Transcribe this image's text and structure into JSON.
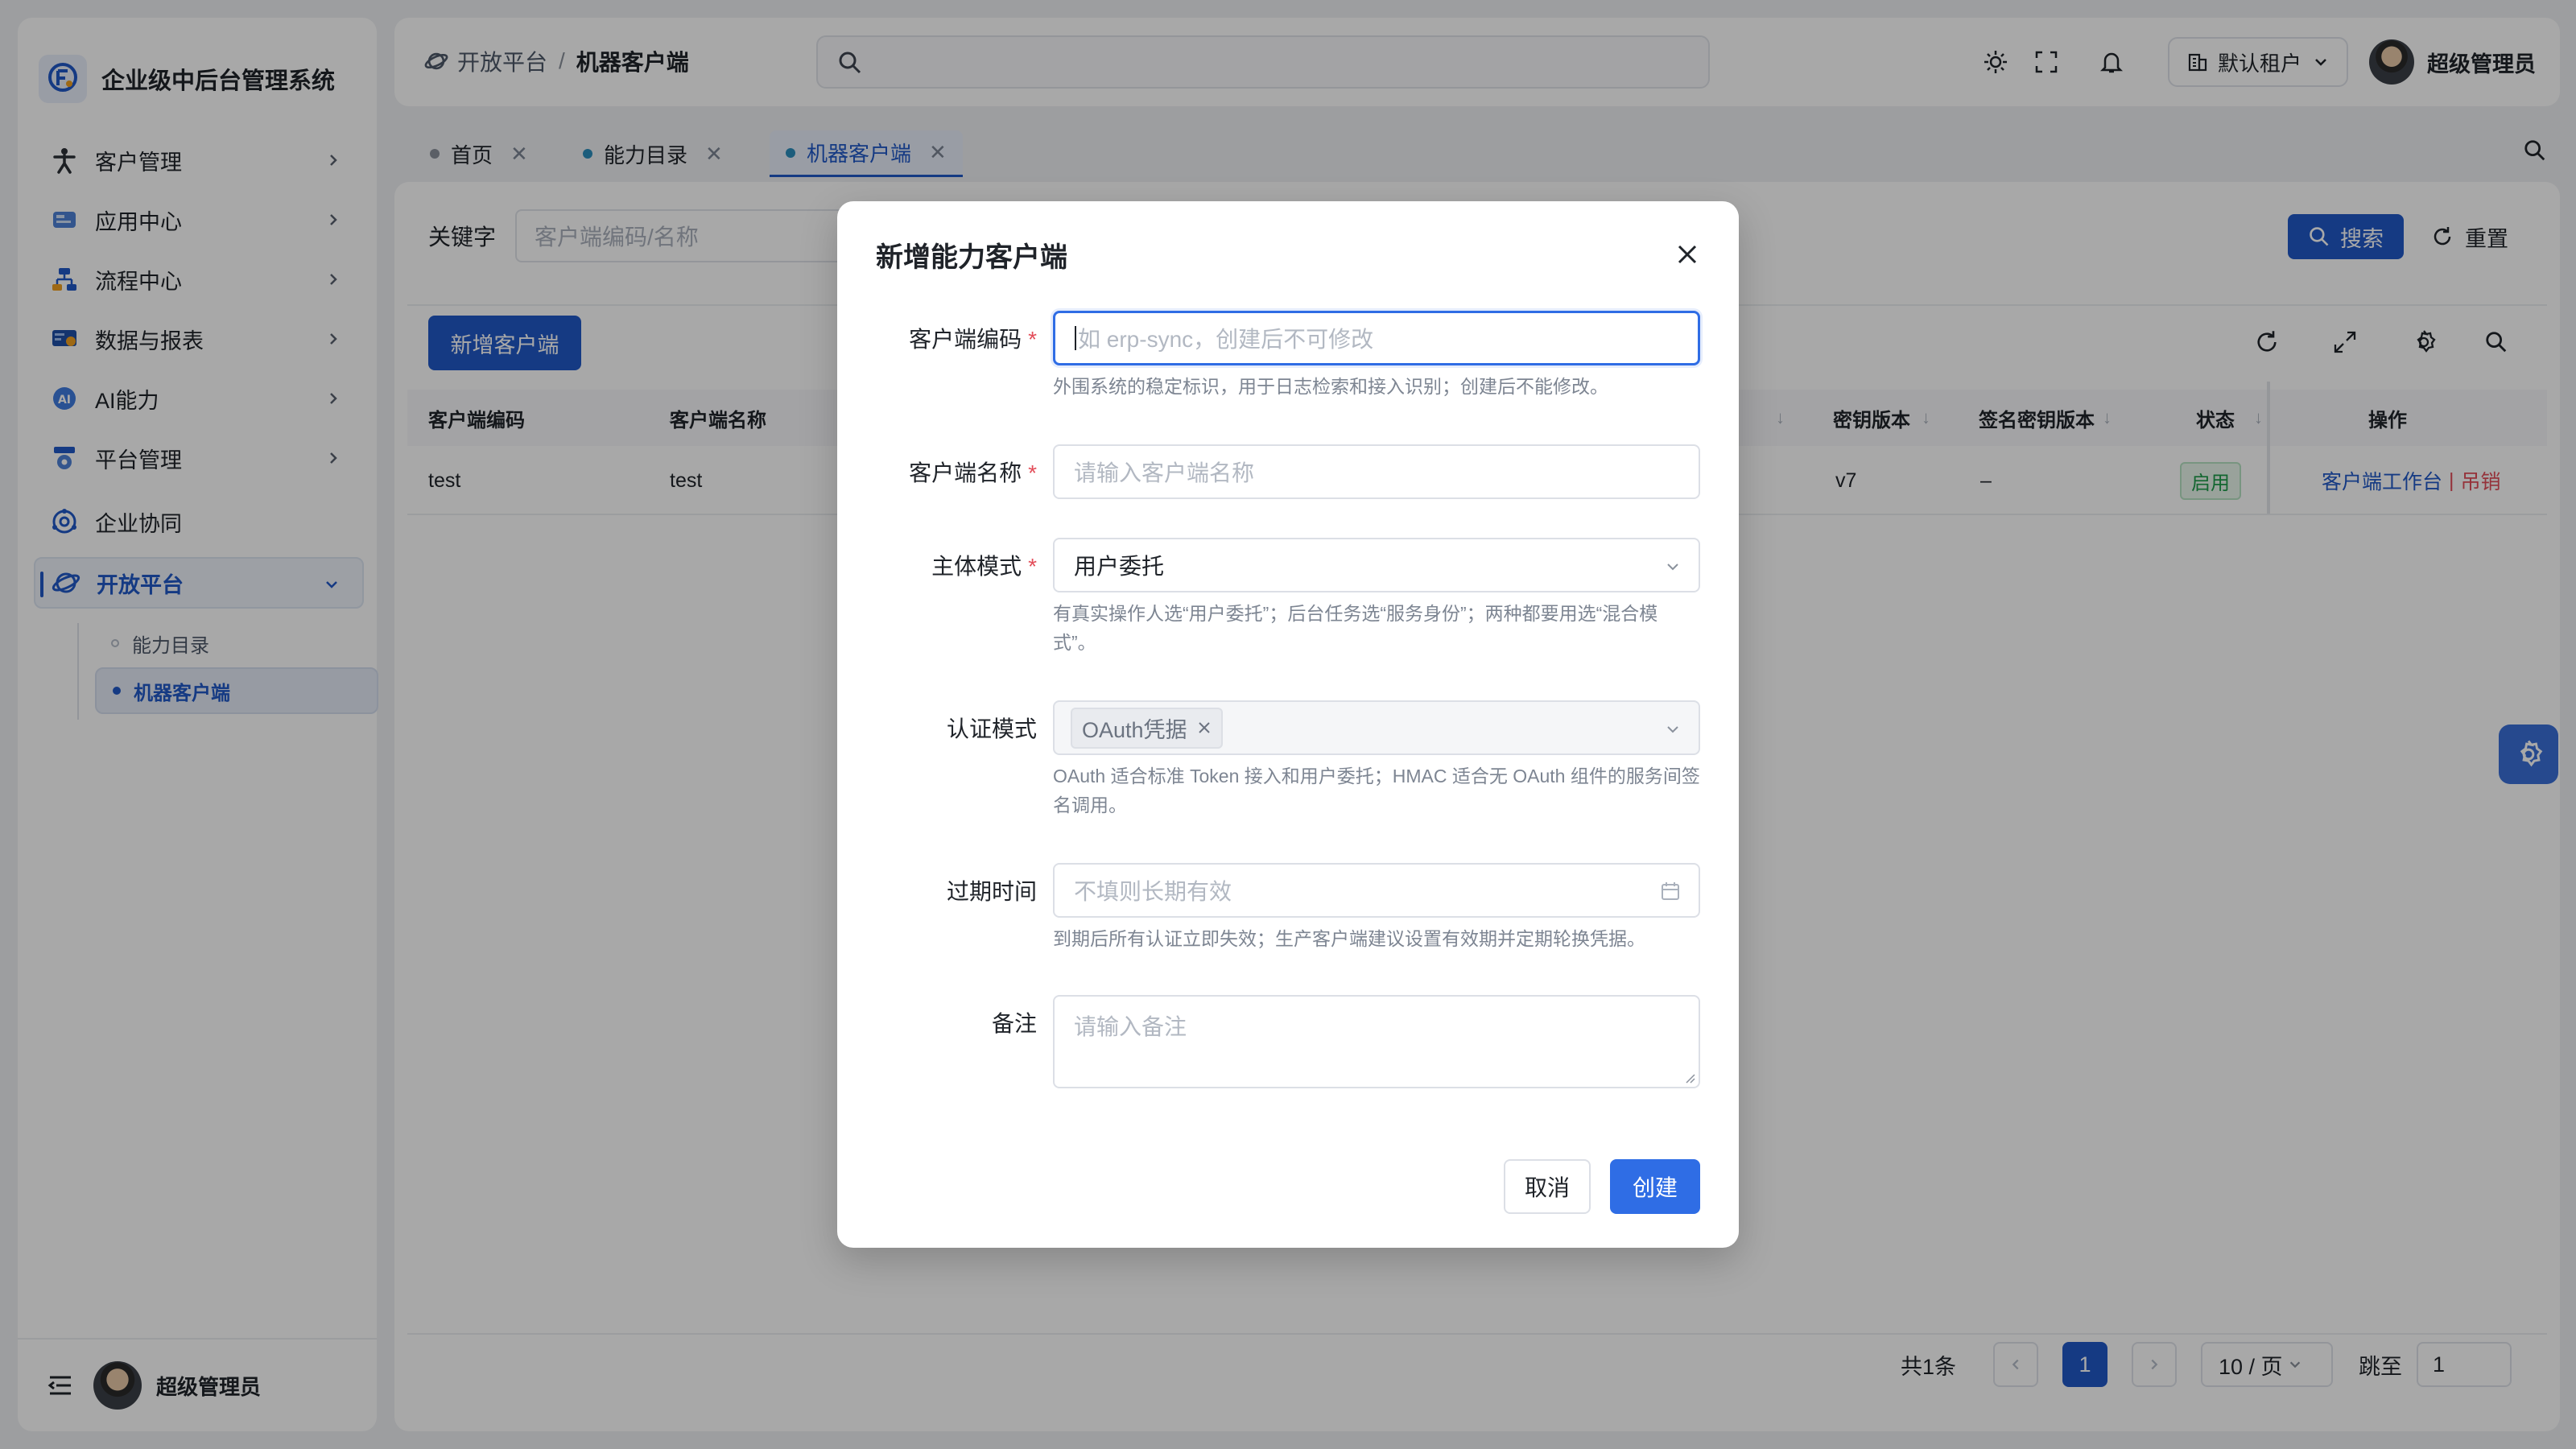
{
  "app": {
    "title": "企业级中后台管理系统"
  },
  "sidebar": {
    "items": [
      {
        "label": "客户管理",
        "icon": "person-icon"
      },
      {
        "label": "应用中心",
        "icon": "app-icon"
      },
      {
        "label": "流程中心",
        "icon": "flow-icon"
      },
      {
        "label": "数据与报表",
        "icon": "report-icon"
      },
      {
        "label": "AI能力",
        "icon": "ai-icon"
      },
      {
        "label": "平台管理",
        "icon": "platform-icon"
      },
      {
        "label": "企业协同",
        "icon": "collab-icon"
      },
      {
        "label": "开放平台",
        "icon": "open-platform-icon"
      }
    ],
    "sub_items": [
      {
        "label": "能力目录"
      },
      {
        "label": "机器客户端"
      }
    ],
    "user": "超级管理员"
  },
  "header": {
    "breadcrumb": [
      "开放平台",
      "机器客户端"
    ],
    "tenant": "默认租户",
    "user": "超级管理员"
  },
  "tabs": [
    {
      "label": "首页"
    },
    {
      "label": "能力目录"
    },
    {
      "label": "机器客户端"
    }
  ],
  "filter": {
    "keyword_label": "关键字",
    "keyword_placeholder": "客户端编码/名称",
    "search": "搜索",
    "reset": "重置"
  },
  "toolbar": {
    "add": "新增客户端"
  },
  "table": {
    "columns": [
      "客户端编码",
      "客户端名称",
      "密钥版本",
      "签名密钥版本",
      "状态",
      "操作"
    ],
    "rows": [
      {
        "code": "test",
        "name": "test",
        "key_version": "v7",
        "sign_version": "–",
        "status": "启用",
        "action_workbench": "客户端工作台",
        "action_sep": "|",
        "action_revoke": "吊销"
      }
    ]
  },
  "pagination": {
    "total": "共1条",
    "page": "1",
    "page_size": "10 / 页",
    "jump_label": "跳至",
    "jump_value": "1"
  },
  "modal": {
    "title": "新增能力客户端",
    "fields": {
      "code_label": "客户端编码",
      "code_placeholder": "如 erp-sync，创建后不可修改",
      "code_help": "外围系统的稳定标识，用于日志检索和接入识别；创建后不能修改。",
      "name_label": "客户端名称",
      "name_placeholder": "请输入客户端名称",
      "subject_label": "主体模式",
      "subject_value": "用户委托",
      "subject_help": "有真实操作人选“用户委托”；后台任务选“服务身份”；两种都要用选“混合模式”。",
      "auth_label": "认证模式",
      "auth_chip": "OAuth凭据",
      "auth_help": "OAuth 适合标准 Token 接入和用户委托；HMAC 适合无 OAuth 组件的服务间签名调用。",
      "expire_label": "过期时间",
      "expire_placeholder": "不填则长期有效",
      "expire_help": "到期后所有认证立即失效；生产客户端建议设置有效期并定期轮换凭据。",
      "remark_label": "备注",
      "remark_placeholder": "请输入备注"
    },
    "required_mark": "*",
    "cancel": "取消",
    "create": "创建"
  },
  "colors": {
    "primary": "#2058c7",
    "modal_primary": "#2f6de5",
    "danger": "#e34d59",
    "success": "#1e9b4a"
  }
}
